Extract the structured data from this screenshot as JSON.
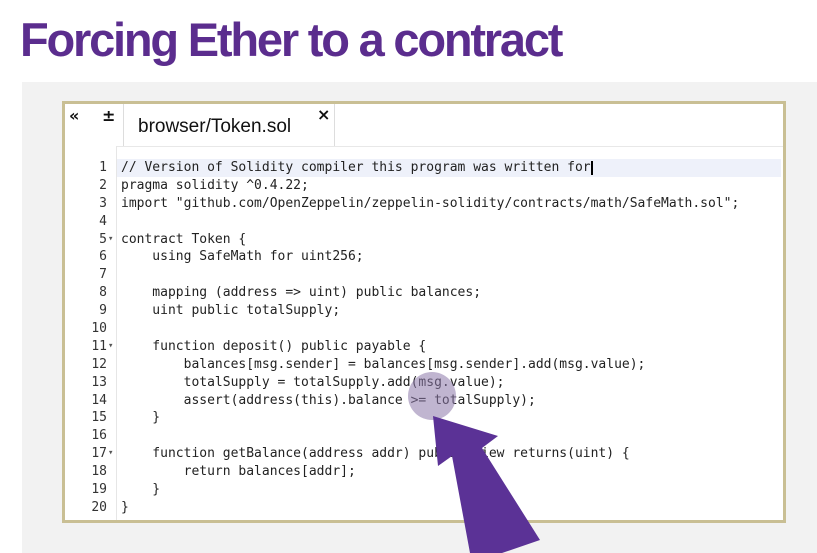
{
  "slide": {
    "title": "Forcing Ether to a contract"
  },
  "editor": {
    "toolbar": {
      "collapse_icon": "«",
      "zoom_icon": "±"
    },
    "tab": {
      "label": "browser/Token.sol",
      "close_icon": "×"
    },
    "code_lines": [
      "// Version of Solidity compiler this program was written for",
      "pragma solidity ^0.4.22;",
      "import \"github.com/OpenZeppelin/zeppelin-solidity/contracts/math/SafeMath.sol\";",
      "",
      "contract Token {",
      "    using SafeMath for uint256;",
      "",
      "    mapping (address => uint) public balances;",
      "    uint public totalSupply;",
      "",
      "    function deposit() public payable {",
      "        balances[msg.sender] = balances[msg.sender].add(msg.value);",
      "        totalSupply = totalSupply.add(msg.value);",
      "        assert(address(this).balance >= totalSupply);",
      "    }",
      "",
      "    function getBalance(address addr) public view returns(uint) {",
      "        return balances[addr];",
      "    }",
      "}"
    ],
    "line_numbers": [
      "1",
      "2",
      "3",
      "4",
      "5",
      "6",
      "7",
      "8",
      "9",
      "10",
      "11",
      "12",
      "13",
      "14",
      "15",
      "16",
      "17",
      "18",
      "19",
      "20"
    ],
    "folded_lines": [
      "5",
      "11",
      "17"
    ]
  },
  "colors": {
    "title": "#5b2d8e",
    "arrow": "#5b3296",
    "editor_border": "#c9bf94",
    "panel_bg": "#f2f2f2"
  },
  "annotation": {
    "type": "arrow",
    "target": "line-14-comparison"
  }
}
